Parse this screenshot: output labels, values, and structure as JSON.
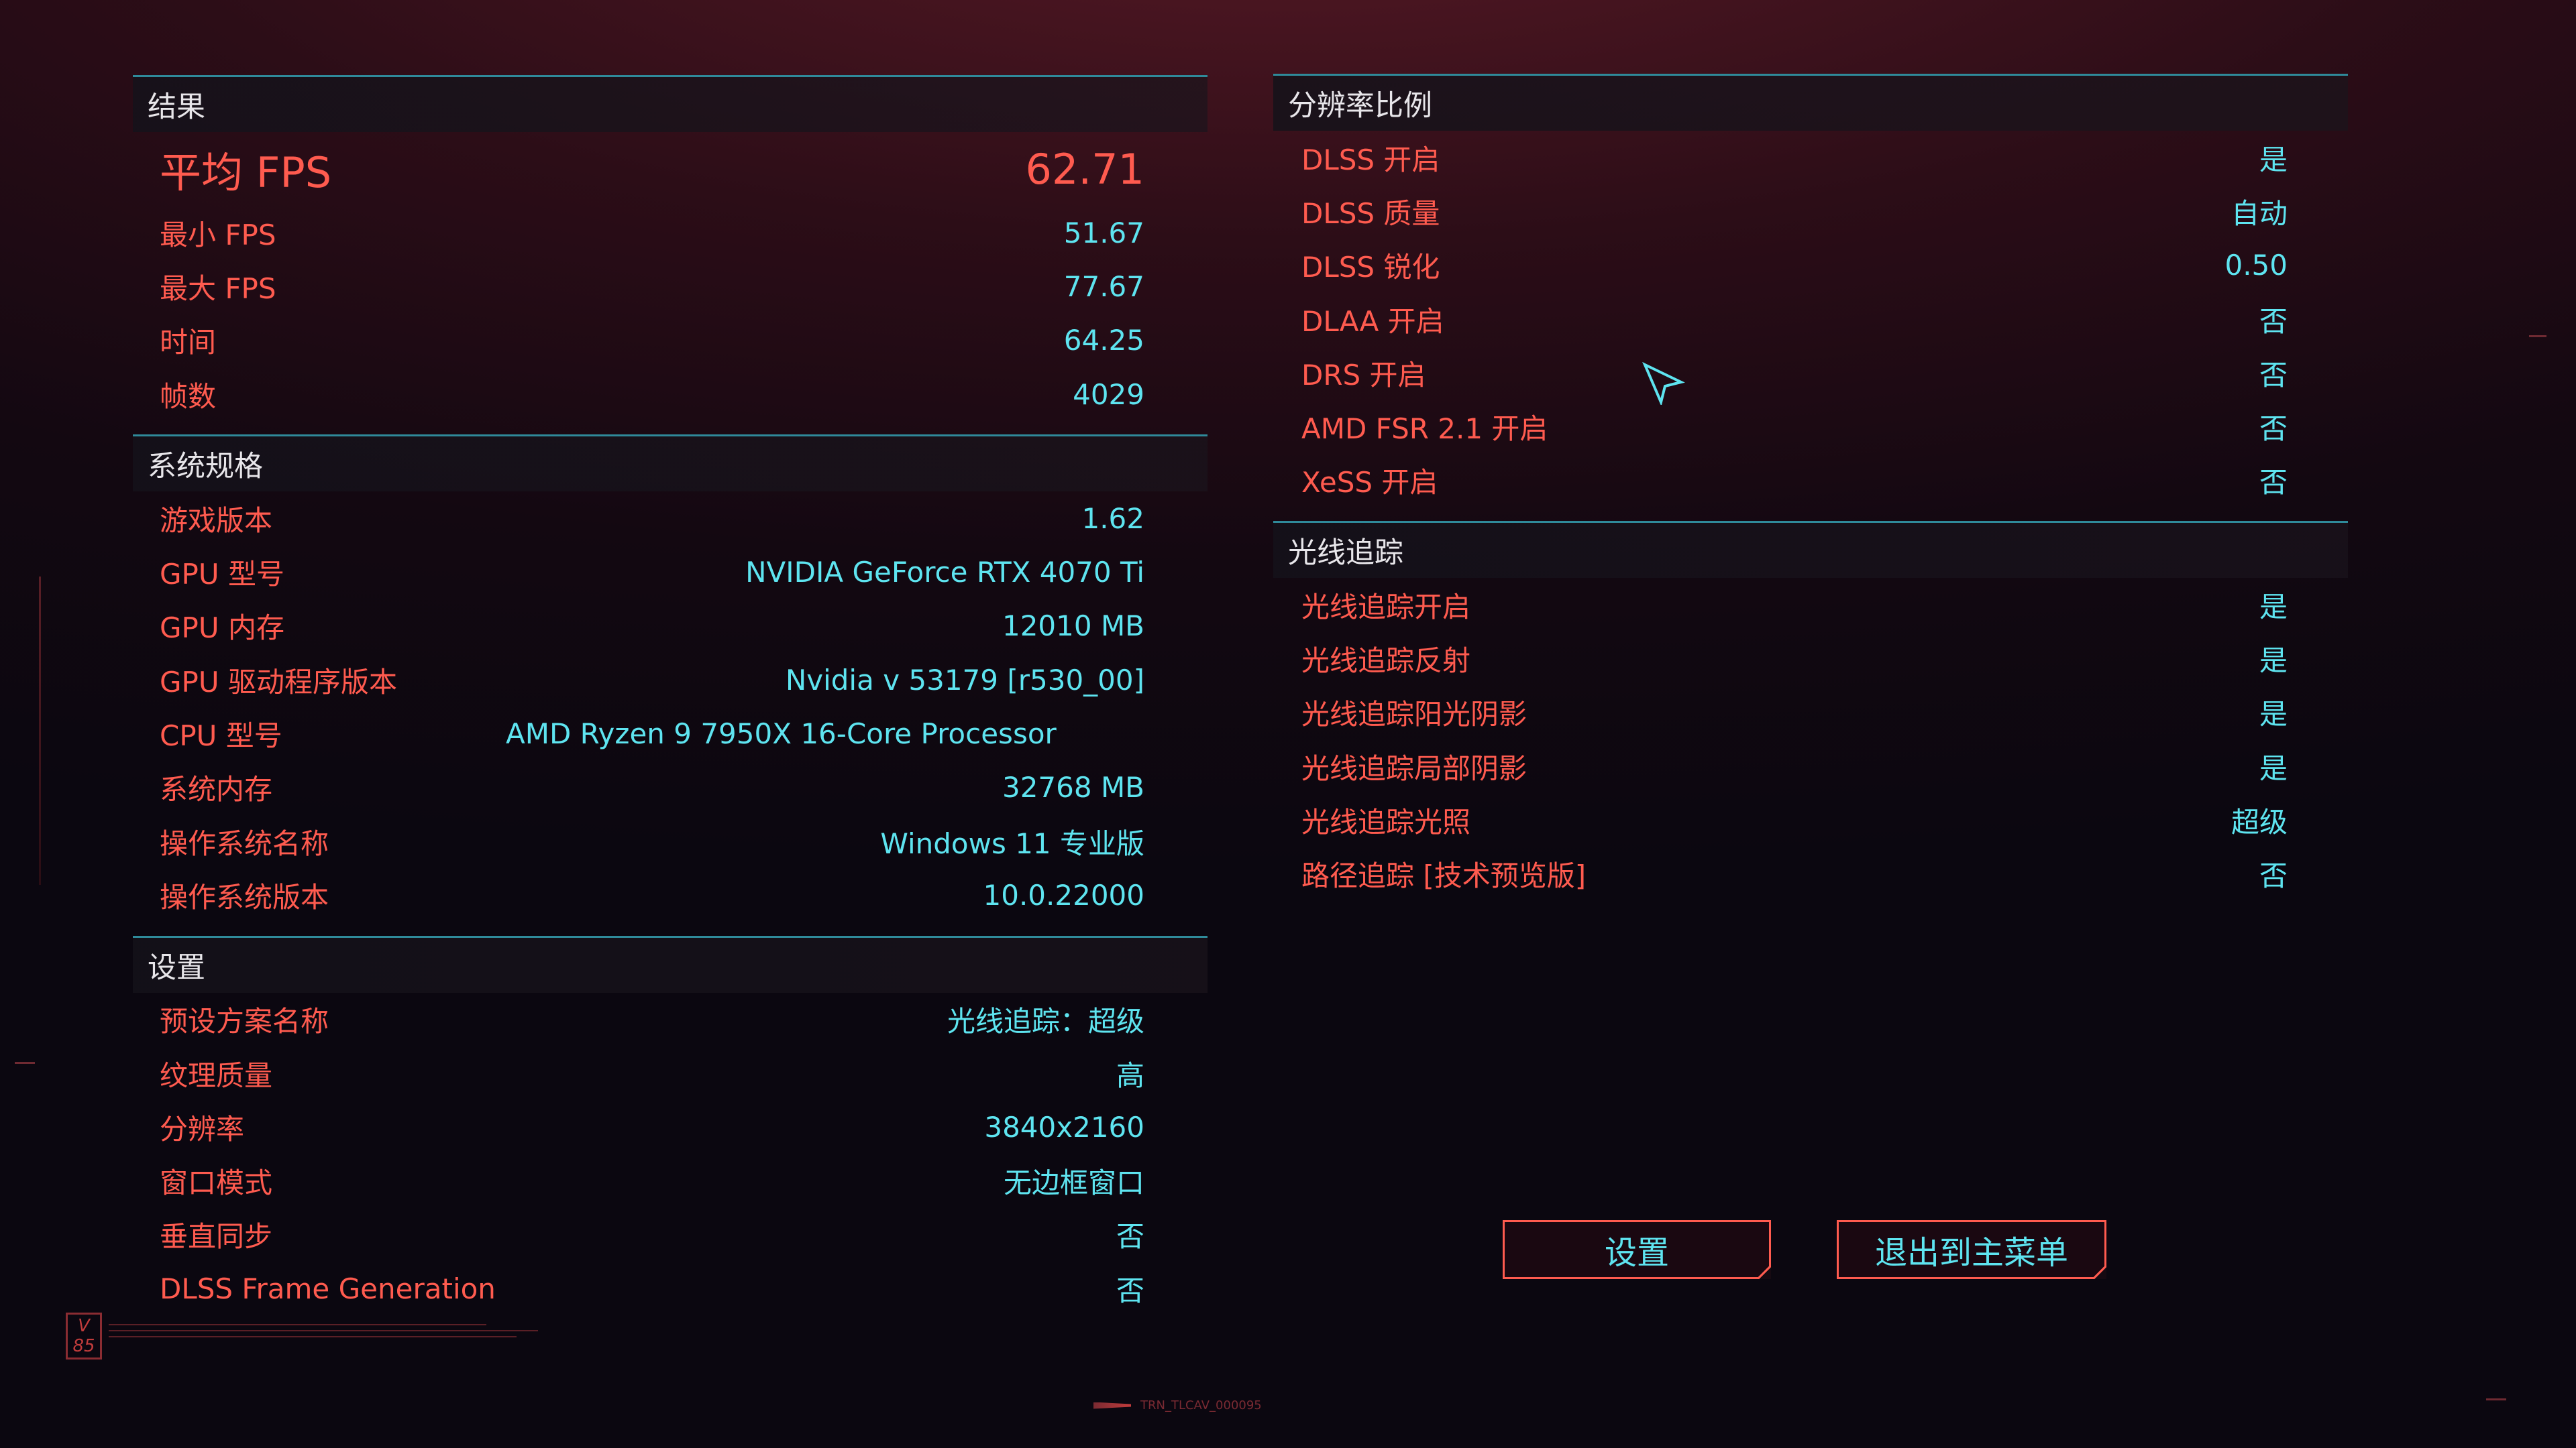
{
  "results": {
    "header": "结果",
    "avg_fps_label": "平均 FPS",
    "avg_fps_value": "62.71",
    "rows": [
      {
        "label": "最小 FPS",
        "value": "51.67"
      },
      {
        "label": "最大 FPS",
        "value": "77.67"
      },
      {
        "label": "时间",
        "value": "64.25"
      },
      {
        "label": "帧数",
        "value": "4029"
      }
    ]
  },
  "system": {
    "header": "系统规格",
    "rows": [
      {
        "label": "游戏版本",
        "value": "1.62"
      },
      {
        "label": "GPU 型号",
        "value": "NVIDIA GeForce RTX 4070 Ti"
      },
      {
        "label": "GPU 内存",
        "value": "12010 MB"
      },
      {
        "label": "GPU 驱动程序版本",
        "value": "Nvidia v 53179 [r530_00]"
      },
      {
        "label": "CPU 型号",
        "value": "AMD Ryzen 9 7950X 16-Core Processor"
      },
      {
        "label": "系统内存",
        "value": "32768 MB"
      },
      {
        "label": "操作系统名称",
        "value": "Windows 11 专业版"
      },
      {
        "label": "操作系统版本",
        "value": "10.0.22000"
      }
    ]
  },
  "settings": {
    "header": "设置",
    "rows": [
      {
        "label": "预设方案名称",
        "value": "光线追踪：超级"
      },
      {
        "label": "纹理质量",
        "value": "高"
      },
      {
        "label": "分辨率",
        "value": "3840x2160"
      },
      {
        "label": "窗口模式",
        "value": "无边框窗口"
      },
      {
        "label": "垂直同步",
        "value": "否"
      },
      {
        "label": "DLSS Frame Generation",
        "value": "否"
      }
    ]
  },
  "resolution_scaling": {
    "header": "分辨率比例",
    "rows": [
      {
        "label": "DLSS 开启",
        "value": "是"
      },
      {
        "label": "DLSS 质量",
        "value": "自动"
      },
      {
        "label": "DLSS 锐化",
        "value": "0.50"
      },
      {
        "label": "DLAA 开启",
        "value": "否"
      },
      {
        "label": "DRS 开启",
        "value": "否"
      },
      {
        "label": "AMD FSR 2.1 开启",
        "value": "否"
      },
      {
        "label": "XeSS 开启",
        "value": "否"
      }
    ]
  },
  "ray_tracing": {
    "header": "光线追踪",
    "rows": [
      {
        "label": "光线追踪开启",
        "value": "是"
      },
      {
        "label": "光线追踪反射",
        "value": "是"
      },
      {
        "label": "光线追踪阳光阴影",
        "value": "是"
      },
      {
        "label": "光线追踪局部阴影",
        "value": "是"
      },
      {
        "label": "光线追踪光照",
        "value": "超级"
      },
      {
        "label": "路径追踪 [技术预览版]",
        "value": "否"
      }
    ]
  },
  "buttons": {
    "settings": "设置",
    "exit": "退出到主菜单"
  },
  "footer": {
    "badge_top": "V",
    "badge_bottom": "85",
    "build_id": "TRN_TLCAV_000095"
  },
  "colors": {
    "label": "#ff5b4f",
    "value": "#5ee4f0",
    "rule": "#2f8a9a",
    "header_text": "#e8e6ea"
  }
}
